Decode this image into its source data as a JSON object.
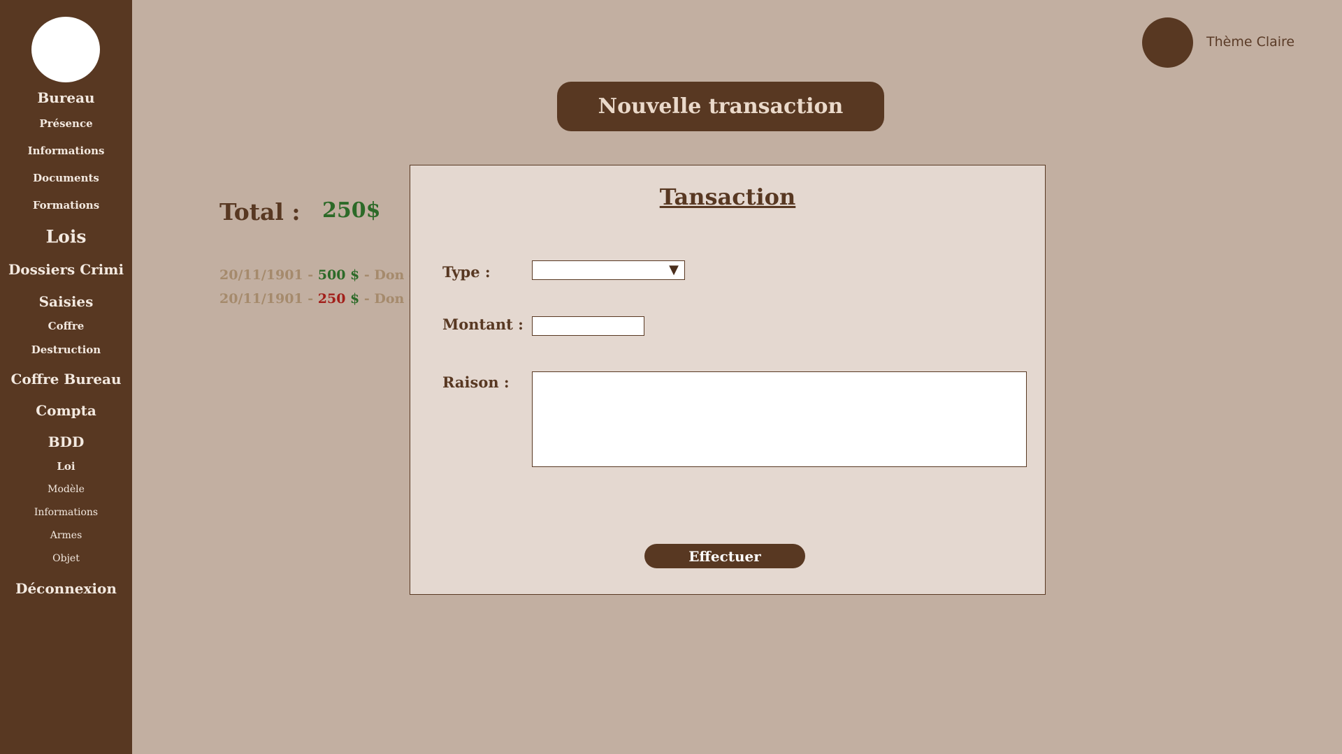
{
  "sidebar": {
    "items": [
      {
        "label": "Bureau",
        "level": 1
      },
      {
        "label": "Présence",
        "level": 2
      },
      {
        "label": "Informations",
        "level": 2
      },
      {
        "label": "Documents",
        "level": 2
      },
      {
        "label": "Formations",
        "level": 2
      },
      {
        "label": "Lois",
        "level": 1
      },
      {
        "label": "Dossiers Crimi",
        "level": 1
      },
      {
        "label": "Saisies",
        "level": 1
      },
      {
        "label": "Coffre",
        "level": 2
      },
      {
        "label": "Destruction",
        "level": 2
      },
      {
        "label": "Coffre Bureau",
        "level": 1
      },
      {
        "label": "Compta",
        "level": 1
      },
      {
        "label": "BDD",
        "level": 1
      },
      {
        "label": "Loi",
        "level": 3
      },
      {
        "label": "Modèle",
        "level": 3
      },
      {
        "label": "Informations",
        "level": 3
      },
      {
        "label": "Armes",
        "level": 3
      },
      {
        "label": "Objet",
        "level": 3
      },
      {
        "label": "Déconnexion",
        "level": 1
      }
    ]
  },
  "theme": {
    "label": "Thème Claire"
  },
  "header": {
    "new_transaction_label": "Nouvelle transaction"
  },
  "summary": {
    "total_label": "Total :",
    "total_value": "250$"
  },
  "transactions": [
    {
      "date": "20/11/1901",
      "sep": " - ",
      "amount": "500",
      "currency": " $",
      "type": "credit",
      "desc": " - Don d"
    },
    {
      "date": "20/11/1901",
      "sep": " - ",
      "amount": "250",
      "currency": " $",
      "type": "debit",
      "desc": " - Don d"
    }
  ],
  "modal": {
    "title": "Tansaction",
    "type_label": "Type :",
    "type_value": "",
    "amount_label": "Montant :",
    "amount_value": "",
    "reason_label": "Raison :",
    "reason_value": "",
    "submit_label": "Effectuer"
  },
  "colors": {
    "sidebar": "#583822",
    "background": "#c2afa1",
    "modal_bg": "#e4d8d0",
    "positive": "#2c6a28",
    "negative": "#a21f1a",
    "muted_text": "#a58a6c"
  }
}
